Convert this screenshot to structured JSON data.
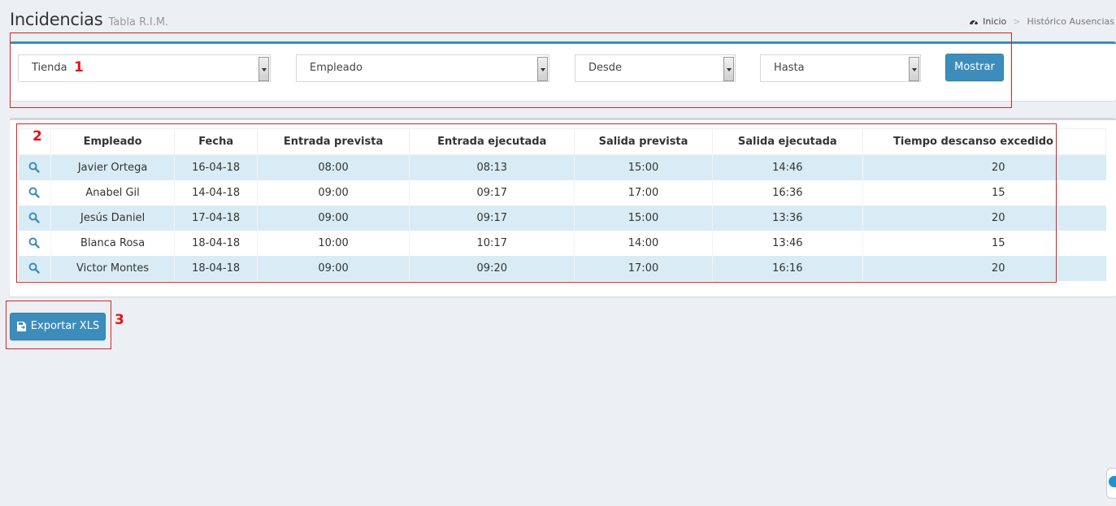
{
  "header": {
    "title": "Incidencias",
    "subtitle": "Tabla R.I.M."
  },
  "breadcrumb": {
    "home": "Inicio",
    "separator": ">",
    "current": "Histórico Ausencias"
  },
  "filters": {
    "tienda": "Tienda",
    "empleado": "Empleado",
    "desde": "Desde",
    "hasta": "Hasta",
    "submit_label": "Mostrar"
  },
  "table": {
    "columns": [
      "Empleado",
      "Fecha",
      "Entrada prevista",
      "Entrada ejecutada",
      "Salida prevista",
      "Salida ejecutada",
      "Tiempo descanso excedido"
    ],
    "rows": [
      [
        "Javier Ortega",
        "16-04-18",
        "08:00",
        "08:13",
        "15:00",
        "14:46",
        "20"
      ],
      [
        "Anabel Gil",
        "14-04-18",
        "09:00",
        "09:17",
        "17:00",
        "16:36",
        "15"
      ],
      [
        "Jesús Daniel",
        "17-04-18",
        "09:00",
        "09:17",
        "15:00",
        "13:36",
        "20"
      ],
      [
        "Blanca Rosa",
        "18-04-18",
        "10:00",
        "10:17",
        "14:00",
        "13:46",
        "15"
      ],
      [
        "Victor Montes",
        "18-04-18",
        "09:00",
        "09:20",
        "17:00",
        "16:16",
        "20"
      ]
    ]
  },
  "export": {
    "label": "Exportar XLS"
  },
  "annotations": [
    "1",
    "2",
    "3"
  ],
  "colors": {
    "accent": "#3c8dbc",
    "row_stripe": "#d9ecf5",
    "annotation": "#e02020"
  }
}
